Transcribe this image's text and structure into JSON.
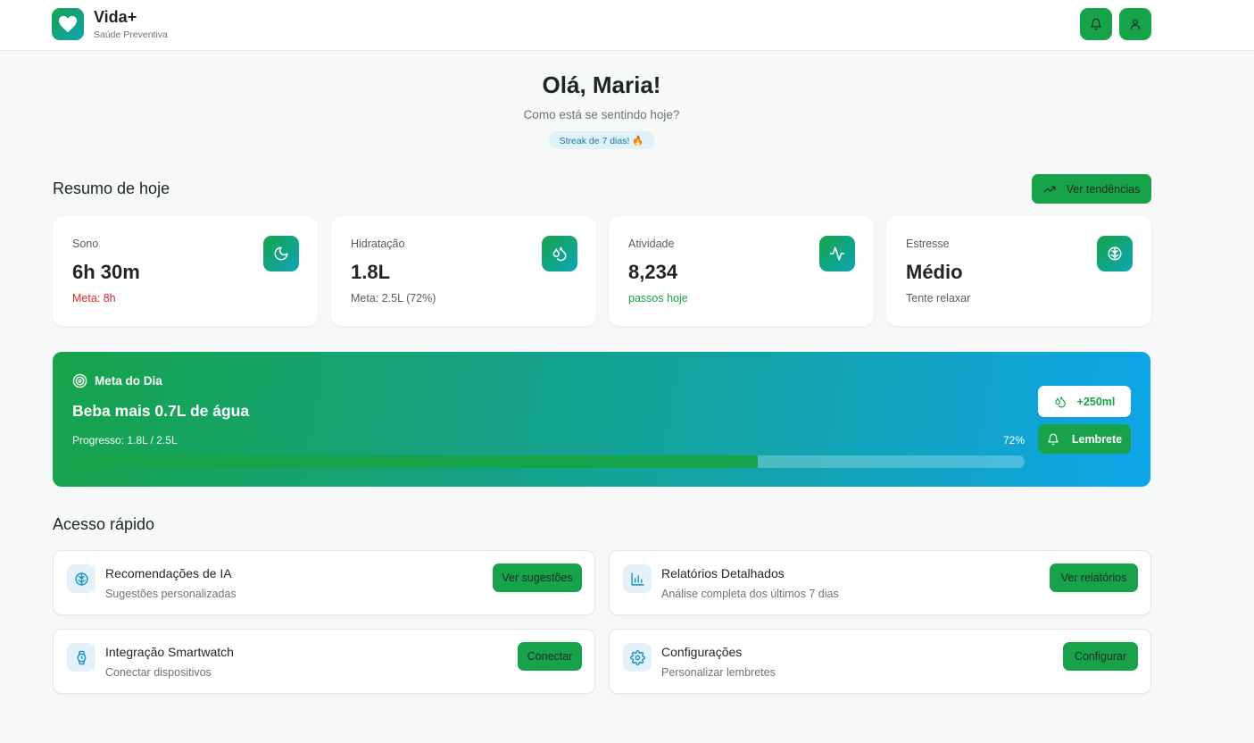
{
  "header": {
    "brand": "Vida+",
    "tagline": "Saúde Preventiva"
  },
  "greeting": {
    "title": "Olá, Maria!",
    "subtitle": "Como está se sentindo hoje?",
    "streak": "Streak de 7 dias! 🔥"
  },
  "summary": {
    "title": "Resumo de hoje",
    "trends_label": "Ver tendências",
    "cards": [
      {
        "label": "Sono",
        "value": "6h 30m",
        "note": "Meta: 8h",
        "note_color": "#dc2626",
        "icon": "moon-icon"
      },
      {
        "label": "Hidratação",
        "value": "1.8L",
        "note": "Meta: 2.5L (72%)",
        "note_color": "#555e5c",
        "icon": "droplets-icon"
      },
      {
        "label": "Atividade",
        "value": "8,234",
        "note": "passos hoje",
        "note_color": "#16a34a",
        "icon": "activity-icon"
      },
      {
        "label": "Estresse",
        "value": "Médio",
        "note": "Tente relaxar",
        "note_color": "#555e5c",
        "icon": "brain-icon"
      }
    ]
  },
  "goal": {
    "heading": "Meta do Dia",
    "title": "Beba mais 0.7L de água",
    "progress_text": "Progresso: 1.8L / 2.5L",
    "percent_label": "72%",
    "progress": 0.72,
    "add_water_label": "+250ml",
    "reminder_label": "Lembrete"
  },
  "quick_access": {
    "title": "Acesso rápido",
    "items": [
      {
        "title": "Recomendações de IA",
        "subtitle": "Sugestões personalizadas",
        "button": "Ver sugestões",
        "icon": "brain-icon"
      },
      {
        "title": "Relatórios Detalhados",
        "subtitle": "Análise completa dos últimos 7 dias",
        "button": "Ver relatórios",
        "icon": "bar-chart-icon"
      },
      {
        "title": "Integração Smartwatch",
        "subtitle": "Conectar dispositivos",
        "button": "Conectar",
        "icon": "watch-icon"
      },
      {
        "title": "Configurações",
        "subtitle": "Personalizar lembretes",
        "button": "Configurar",
        "icon": "settings-icon"
      }
    ]
  },
  "colors": {
    "primary": "#16a34a",
    "accent": "#0ea5e9",
    "danger": "#dc2626"
  }
}
